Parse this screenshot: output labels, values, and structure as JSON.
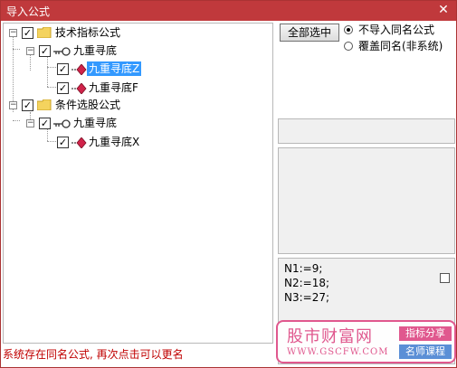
{
  "window": {
    "title": "导入公式",
    "close_glyph": "✕"
  },
  "tree": {
    "nodes": [
      {
        "label": "技术指标公式",
        "checked": true,
        "expanded": true,
        "icon": "folder-icon"
      },
      {
        "label": "九重寻底",
        "checked": true,
        "expanded": true,
        "icon": "key-icon"
      },
      {
        "label": "九重寻底Z",
        "checked": true,
        "selected": true,
        "icon": "formula-gem-icon"
      },
      {
        "label": "九重寻底F",
        "checked": true,
        "icon": "formula-gem-icon"
      },
      {
        "label": "条件选股公式",
        "checked": true,
        "expanded": true,
        "icon": "folder-icon"
      },
      {
        "label": "九重寻底",
        "checked": true,
        "expanded": true,
        "icon": "key-icon"
      },
      {
        "label": "九重寻底X",
        "checked": true,
        "icon": "formula-gem-icon"
      }
    ],
    "expand_glyph": "−",
    "check_glyph": "✓"
  },
  "options": {
    "select_all_label": "全部选中",
    "radio_skip_label": "不导入同名公式",
    "radio_overwrite_label": "覆盖同名(非系统)",
    "selected_option": "不导入同名公式"
  },
  "code_preview": {
    "lines": [
      "N1:=9;",
      "N2:=18;",
      "N3:=27;"
    ]
  },
  "watermark": {
    "brand": "股市财富网",
    "url": "WWW.GSCFW.COM",
    "tag1": "指标分享",
    "tag2": "名师课程"
  },
  "status": {
    "message": "系统存在同名公式, 再次点击可以更名"
  },
  "colors": {
    "titlebar": "#c0393c",
    "selection": "#3399ff",
    "status_text": "#c00000",
    "watermark_pink": "#e0588e",
    "watermark_blue": "#5b8fd6"
  }
}
